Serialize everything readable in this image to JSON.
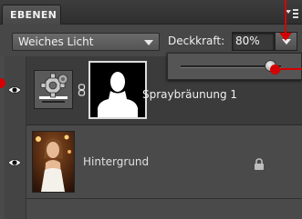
{
  "panel": {
    "tab_label": "EBENEN",
    "menu_icon": "panel-menu-icon"
  },
  "toolbar": {
    "blend_mode": "Weiches Licht",
    "opacity_label": "Deckkraft:",
    "opacity_value": "80%"
  },
  "opacity_slider": {
    "value_fraction": 0.8
  },
  "layers": [
    {
      "name": "Spraybräunung 1",
      "visible": true,
      "type": "adjustment",
      "icon": "adjustment-gear-icon",
      "has_mask": true
    },
    {
      "name": "Hintergrund",
      "visible": true,
      "type": "background",
      "locked": true,
      "icon": "lock-icon"
    }
  ],
  "colors": {
    "panel_bg": "#4a4a4a",
    "selected_row": "#3b3b3b",
    "callout": "#d40000"
  }
}
